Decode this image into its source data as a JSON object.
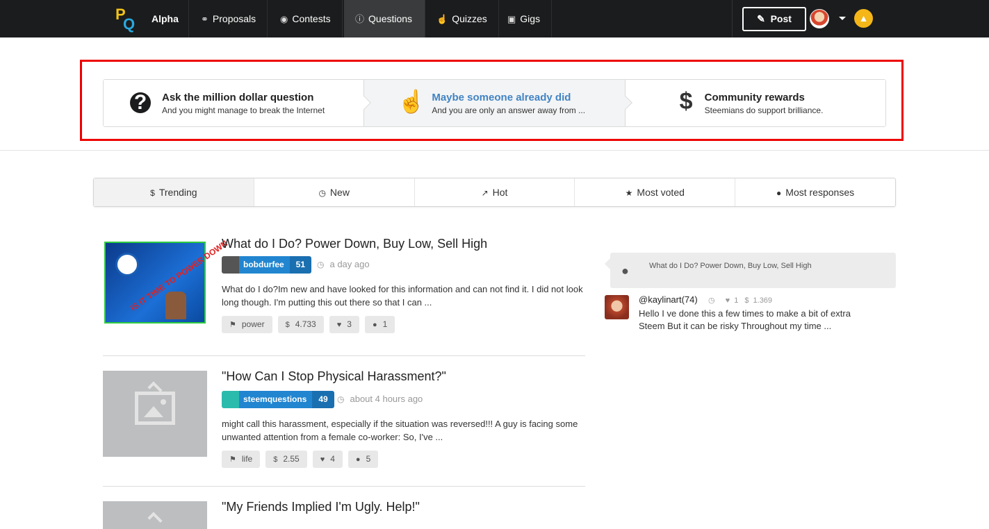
{
  "nav": {
    "brand": "Alpha",
    "items": [
      {
        "label": "Proposals",
        "icon": "handshake-icon"
      },
      {
        "label": "Contests",
        "icon": "gamepad-icon"
      },
      {
        "label": "Questions",
        "icon": "question-circle-icon"
      },
      {
        "label": "Quizzes",
        "icon": "pointer-hand-icon"
      },
      {
        "label": "Gigs",
        "icon": "money-icon"
      }
    ],
    "active": "Questions",
    "post_label": "Post"
  },
  "steps": [
    {
      "title": "Ask the million dollar question",
      "desc": "And you might manage to break the Internet",
      "icon": "question-circle-icon"
    },
    {
      "title": "Maybe someone already did",
      "desc": "And you are only an answer away from ...",
      "icon": "pointer-hand-icon"
    },
    {
      "title": "Community rewards",
      "desc": "Steemians do support brilliance.",
      "icon": "dollar-icon"
    }
  ],
  "tabs": [
    {
      "label": "Trending",
      "icon": "dollar-icon"
    },
    {
      "label": "New",
      "icon": "clock-icon"
    },
    {
      "label": "Hot",
      "icon": "line-chart-icon"
    },
    {
      "label": "Most voted",
      "icon": "star-icon"
    },
    {
      "label": "Most responses",
      "icon": "comment-icon"
    }
  ],
  "posts": [
    {
      "title": "What do I Do? Power Down, Buy Low, Sell High",
      "author": "bobdurfee",
      "score": "51",
      "time": "a day ago",
      "excerpt": "What do I do?Im new and have looked for this information and can not find it. I did not look long though. I'm putting this out there so that I can ...",
      "tag": "power",
      "payout": "4.733",
      "votes": "3",
      "comments": "1",
      "image_text": "IS IT TIME TO POWER DOWN"
    },
    {
      "title": "\"How Can I Stop Physical Harassment?\"",
      "author": "steemquestions",
      "score": "49",
      "time": "about 4 hours ago",
      "excerpt": "might call this harassment, especially if the situation was reversed!!! A guy is facing some unwanted attention from a female co-worker: So, I've ...",
      "tag": "life",
      "payout": "2.55",
      "votes": "4",
      "comments": "5"
    },
    {
      "title": "\"My Friends Implied I'm Ugly. Help!\""
    }
  ],
  "side": {
    "question": "What do I Do? Power Down, Buy Low, Sell High",
    "commenter": "@kaylinart(74)",
    "votes": "1",
    "payout": "1.369",
    "comment": "Hello I ve done this a few times to make a bit of extra Steem But it can be risky Throughout my time ..."
  }
}
